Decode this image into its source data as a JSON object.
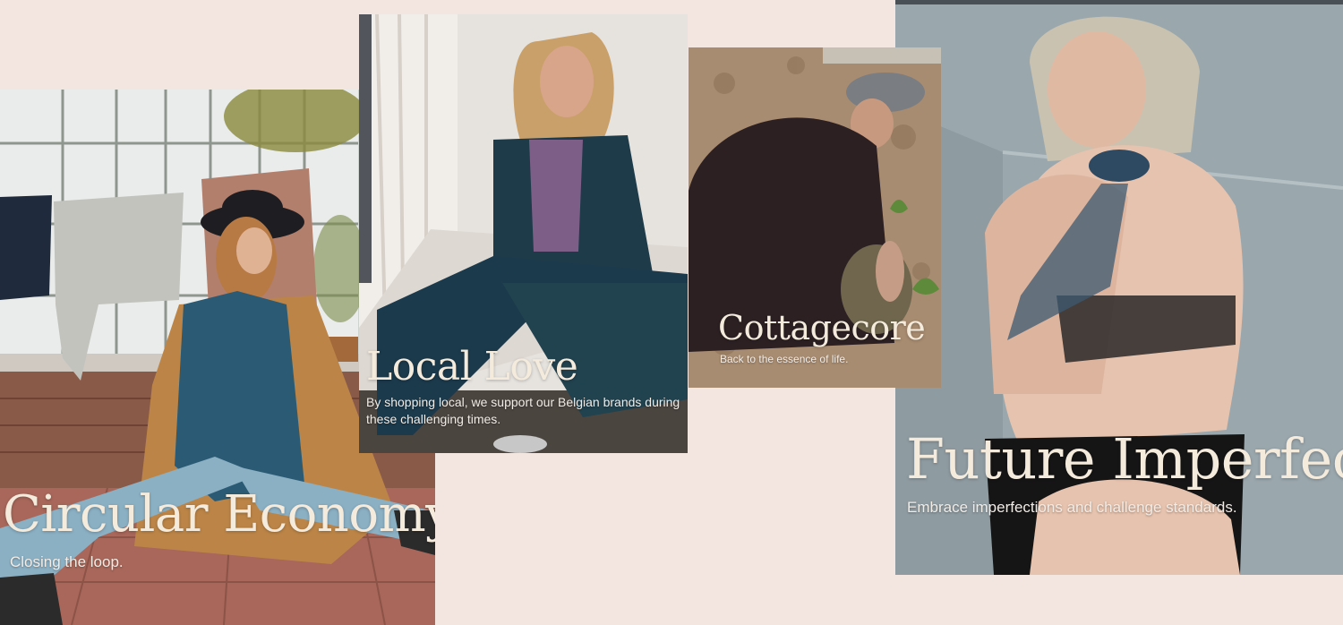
{
  "cards": {
    "circular_economy": {
      "title": "Circular Economy",
      "subtitle": "Closing the loop."
    },
    "local_love": {
      "title": "Local Love",
      "subtitle": "By shopping local, we support our Belgian brands during these challenging times."
    },
    "cottagecore": {
      "title": "Cottagecore",
      "subtitle": "Back to the essence of life."
    },
    "future_imperfect": {
      "title": "Future Imperfect",
      "subtitle": "Embrace imperfections and challenge standards."
    }
  },
  "colors": {
    "page_background": "#f3e5df",
    "title_text": "#f4ebdd",
    "subtitle_text": "#f2ece6"
  }
}
